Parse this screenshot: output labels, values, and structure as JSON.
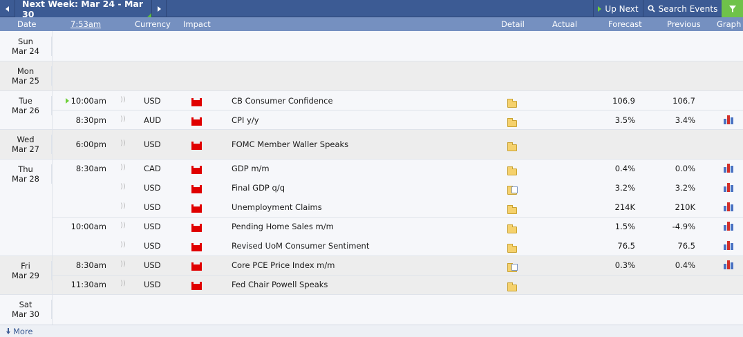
{
  "topbar": {
    "week_title": "Next Week: Mar 24 - Mar 30",
    "up_next_label": "Up Next",
    "search_label": "Search Events"
  },
  "header": {
    "date": "Date",
    "time": "7:53am",
    "currency": "Currency",
    "impact": "Impact",
    "detail": "Detail",
    "actual": "Actual",
    "forecast": "Forecast",
    "previous": "Previous",
    "graph": "Graph"
  },
  "days": [
    {
      "day": "Sun",
      "date": "Mar 24"
    },
    {
      "day": "Mon",
      "date": "Mar 25"
    },
    {
      "day": "Tue",
      "date": "Mar 26"
    },
    {
      "day": "Wed",
      "date": "Mar 27"
    },
    {
      "day": "Thu",
      "date": "Mar 28"
    },
    {
      "day": "Fri",
      "date": "Mar 29"
    },
    {
      "day": "Sat",
      "date": "Mar 30"
    }
  ],
  "events": [
    {
      "time": "10:00am",
      "currency": "USD",
      "event": "CB Consumer Confidence",
      "forecast": "106.9",
      "previous": "106.7"
    },
    {
      "time": "8:30pm",
      "currency": "AUD",
      "event": "CPI y/y",
      "forecast": "3.5%",
      "previous": "3.4%"
    },
    {
      "time": "6:00pm",
      "currency": "USD",
      "event": "FOMC Member Waller Speaks",
      "forecast": "",
      "previous": ""
    },
    {
      "time": "8:30am",
      "currency": "CAD",
      "event": "GDP m/m",
      "forecast": "0.4%",
      "previous": "0.0%"
    },
    {
      "time": "",
      "currency": "USD",
      "event": "Final GDP q/q",
      "forecast": "3.2%",
      "previous": "3.2%"
    },
    {
      "time": "",
      "currency": "USD",
      "event": "Unemployment Claims",
      "forecast": "214K",
      "previous": "210K"
    },
    {
      "time": "10:00am",
      "currency": "USD",
      "event": "Pending Home Sales m/m",
      "forecast": "1.5%",
      "previous": "-4.9%"
    },
    {
      "time": "",
      "currency": "USD",
      "event": "Revised UoM Consumer Sentiment",
      "forecast": "76.5",
      "previous": "76.5"
    },
    {
      "time": "8:30am",
      "currency": "USD",
      "event": "Core PCE Price Index m/m",
      "forecast": "0.3%",
      "previous": "0.4%"
    },
    {
      "time": "11:30am",
      "currency": "USD",
      "event": "Fed Chair Powell Speaks",
      "forecast": "",
      "previous": ""
    }
  ],
  "more_label": "More",
  "colors": {
    "bar": "#3c5b94",
    "header": "#7590c0",
    "high_impact": "#e00000",
    "filter": "#6fc24a"
  }
}
